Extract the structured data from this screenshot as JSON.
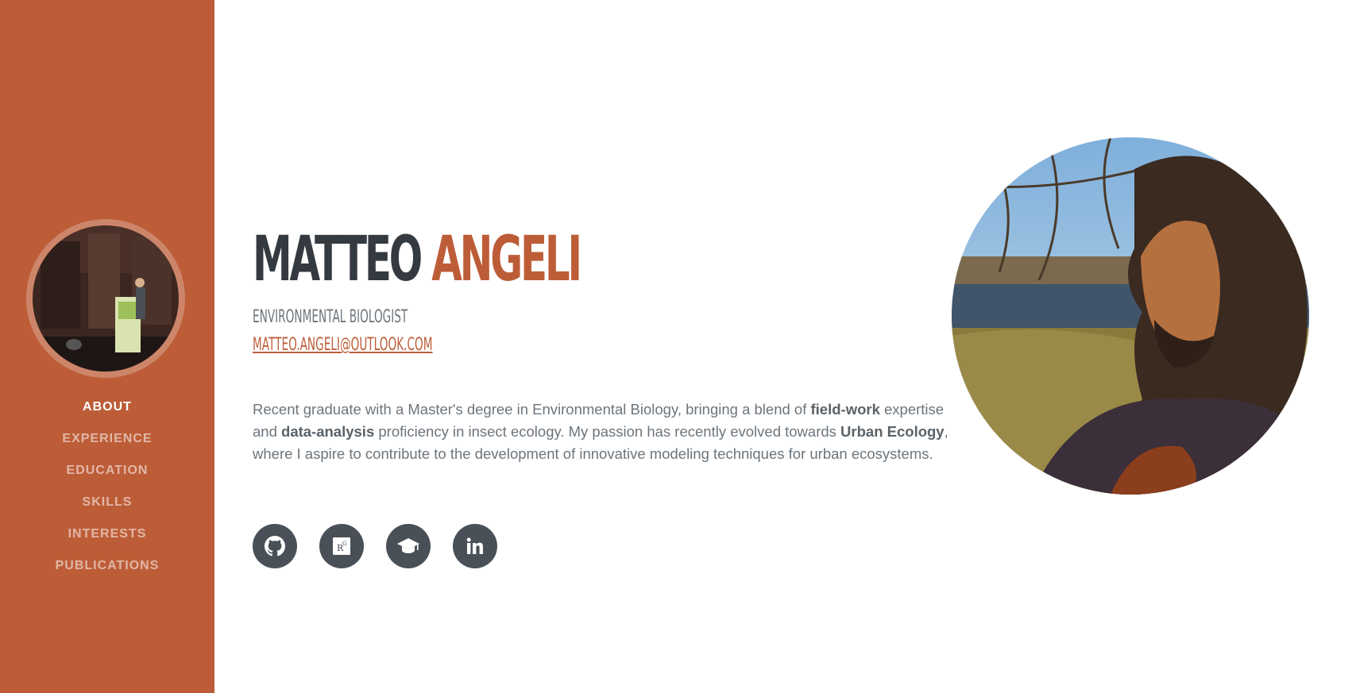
{
  "sidebar": {
    "bg_color": "#bd5d38",
    "nav": [
      {
        "label": "About",
        "active": true
      },
      {
        "label": "Experience",
        "active": false
      },
      {
        "label": "Education",
        "active": false
      },
      {
        "label": "Skills",
        "active": false
      },
      {
        "label": "Interests",
        "active": false
      },
      {
        "label": "Publications",
        "active": false
      }
    ]
  },
  "about": {
    "first_name": "MATTEO",
    "last_name": "ANGELI",
    "subtitle": "Environmental Biologist",
    "email": "matteo.angeli@outlook.com",
    "lead": {
      "p1": "Recent graduate with a Master's degree in Environmental Biology, bringing a blend of ",
      "b1": "field-work",
      "p2": " expertise and ",
      "b2": "data-analysis",
      "p3": " proficiency in insect ecology. My passion has recently evolved towards ",
      "b3": "Urban Ecology",
      "p4": ", where I aspire to contribute to the development of innovative modeling techniques for urban ecosystems."
    },
    "social": [
      {
        "icon": "github-icon"
      },
      {
        "icon": "researchgate-icon"
      },
      {
        "icon": "graduation-cap-icon"
      },
      {
        "icon": "linkedin-icon"
      }
    ]
  },
  "colors": {
    "accent": "#bd5d38",
    "heading": "#343a40",
    "text": "#6c757d",
    "social_bg": "#495057"
  }
}
